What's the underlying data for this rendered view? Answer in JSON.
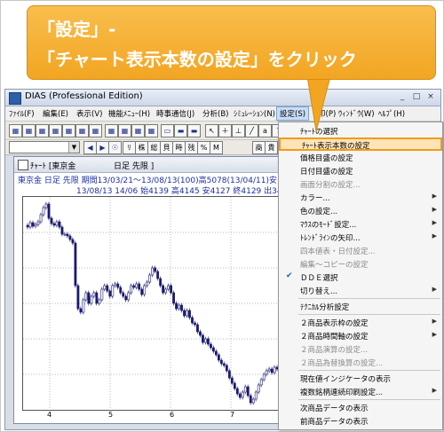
{
  "callout": {
    "line1": "「設定」-",
    "line2": "「チャート表示本数の設定」をクリック"
  },
  "window": {
    "title": "DIAS (Professional Edition)",
    "controls": [
      "_",
      "□",
      "×"
    ]
  },
  "menubar": [
    "ﾌｧｲﾙ(F)",
    "編集(E)",
    "表示(V)",
    "機能ﾒﾆｭｰ(H)",
    "時事通信(J)",
    "分析(B)",
    "ｼﾐｭﾚｰｼｮﾝ(N)",
    "設定(S)",
    "印(P)",
    "ｳｨﾝﾄﾞｳ(W)",
    "ﾍﾙﾌﾟ(H)"
  ],
  "toolbar2_labels": [
    "◀",
    "▶",
    "☉",
    "ﾘ",
    "株",
    "総",
    "貝",
    "時",
    "残",
    "%",
    "M",
    "商",
    "貴"
  ],
  "chart_window": {
    "title": "ﾁｬｰﾄ [東京金",
    "title_right": "日足 先限 ]",
    "info_line1": "東京金 日足 先限 期間13/03/21～13/08/13(100)高5078(13/04/11)安",
    "info_line2": "13/08/13 14/06 始4139 高4145 安4127 終4129 出3411 前",
    "x_labels": [
      "4",
      "5",
      "6",
      "7"
    ]
  },
  "menu": {
    "items": [
      {
        "label": "ﾁｬｰﾄの選択",
        "disabled": false,
        "submenu": false
      },
      {
        "label": "ﾁｬｰﾄ表示本数の設定",
        "disabled": false,
        "submenu": false,
        "highlighted": true
      },
      {
        "label": "価格目盛の設定",
        "disabled": false,
        "submenu": false
      },
      {
        "label": "日付目盛の設定",
        "disabled": false,
        "submenu": false
      },
      {
        "label": "画面分割の設定...",
        "disabled": true,
        "submenu": false
      },
      {
        "label": "カラー...",
        "disabled": false,
        "submenu": true
      },
      {
        "label": "色の設定...",
        "disabled": false,
        "submenu": true
      },
      {
        "label": "ﾏｳｽのﾓｰﾄﾞ設定...",
        "disabled": false,
        "submenu": true
      },
      {
        "label": "ﾄﾚﾝﾄﾞﾗｲﾝの矢印...",
        "disabled": false,
        "submenu": true
      },
      {
        "label": "四本値表・日付設定...",
        "disabled": true,
        "submenu": false
      },
      {
        "label": "編集～コピーの設定",
        "disabled": true,
        "submenu": false
      },
      {
        "label": "ＤＤＥ選択",
        "disabled": false,
        "submenu": false,
        "checked": true
      },
      {
        "label": "切り替え...",
        "disabled": false,
        "submenu": true
      },
      {
        "label": "ﾃｸﾆｶﾙ分析設定",
        "disabled": false,
        "submenu": false
      },
      {
        "label": "２商品表示枠の設定",
        "disabled": false,
        "submenu": true
      },
      {
        "label": "２商品時間軸の設定",
        "disabled": false,
        "submenu": true
      },
      {
        "label": "２商品演算の設定...",
        "disabled": true,
        "submenu": false
      },
      {
        "label": "２商品為替換算の設定...",
        "disabled": true,
        "submenu": false
      },
      {
        "label": "現在値インジケータの表示",
        "disabled": false,
        "submenu": false
      },
      {
        "label": "複数銘柄連続印刷設定...",
        "disabled": false,
        "submenu": true
      },
      {
        "label": "次商品データの表示",
        "disabled": false,
        "submenu": false
      },
      {
        "label": "前商品データの表示",
        "disabled": false,
        "submenu": false
      }
    ]
  },
  "chart_data": {
    "type": "candlestick",
    "title": "東京金 日足 先限 期間13/03/21～13/08/13(100)",
    "x_ticks": [
      "4",
      "5",
      "6",
      "7"
    ],
    "high": 5078,
    "high_date": "13/04/11",
    "last_bar": {
      "date": "13/08/13",
      "open": 4139,
      "high": 4145,
      "low": 4127,
      "close": 4129,
      "volume": 3411
    },
    "close_series": [
      4930,
      4955,
      4935,
      4945,
      4960,
      5000,
      5040,
      5060,
      4980,
      4950,
      4940,
      4960,
      4930,
      4890,
      4890,
      4880,
      4860,
      4840,
      4600,
      4470,
      4450,
      4520,
      4560,
      4500,
      4540,
      4560,
      4500,
      4520,
      4580,
      4600,
      4570,
      4540,
      4600,
      4610,
      4590,
      4560,
      4540,
      4520,
      4560,
      4600,
      4590,
      4610,
      4580,
      4550,
      4600,
      4620,
      4660,
      4700,
      4680,
      4640,
      4600,
      4560,
      4580,
      4600,
      4560,
      4500,
      4470,
      4490,
      4460,
      4430,
      4460,
      4420,
      4390,
      4380,
      4340,
      4320,
      4280,
      4300,
      4270,
      4250,
      4230,
      4210,
      4180,
      4160,
      4150,
      4120,
      4080,
      4050,
      4020,
      3990,
      3970,
      4000,
      4030,
      3980,
      3940,
      3960,
      4000,
      4040,
      4070,
      4100,
      4120,
      4130,
      4110,
      4140,
      4130,
      4120,
      4150,
      4140,
      4135,
      4129
    ]
  }
}
